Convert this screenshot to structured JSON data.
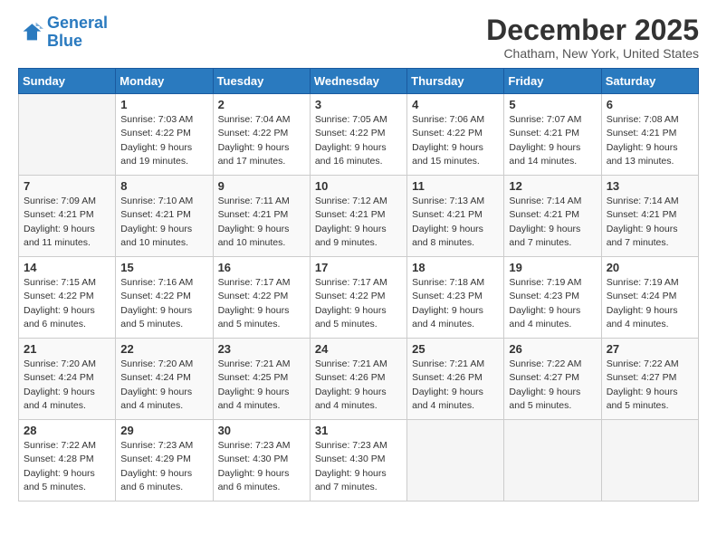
{
  "header": {
    "logo_line1": "General",
    "logo_line2": "Blue",
    "month": "December 2025",
    "location": "Chatham, New York, United States"
  },
  "days_of_week": [
    "Sunday",
    "Monday",
    "Tuesday",
    "Wednesday",
    "Thursday",
    "Friday",
    "Saturday"
  ],
  "weeks": [
    [
      {
        "num": "",
        "info": ""
      },
      {
        "num": "1",
        "info": "Sunrise: 7:03 AM\nSunset: 4:22 PM\nDaylight: 9 hours\nand 19 minutes."
      },
      {
        "num": "2",
        "info": "Sunrise: 7:04 AM\nSunset: 4:22 PM\nDaylight: 9 hours\nand 17 minutes."
      },
      {
        "num": "3",
        "info": "Sunrise: 7:05 AM\nSunset: 4:22 PM\nDaylight: 9 hours\nand 16 minutes."
      },
      {
        "num": "4",
        "info": "Sunrise: 7:06 AM\nSunset: 4:22 PM\nDaylight: 9 hours\nand 15 minutes."
      },
      {
        "num": "5",
        "info": "Sunrise: 7:07 AM\nSunset: 4:21 PM\nDaylight: 9 hours\nand 14 minutes."
      },
      {
        "num": "6",
        "info": "Sunrise: 7:08 AM\nSunset: 4:21 PM\nDaylight: 9 hours\nand 13 minutes."
      }
    ],
    [
      {
        "num": "7",
        "info": "Sunrise: 7:09 AM\nSunset: 4:21 PM\nDaylight: 9 hours\nand 11 minutes."
      },
      {
        "num": "8",
        "info": "Sunrise: 7:10 AM\nSunset: 4:21 PM\nDaylight: 9 hours\nand 10 minutes."
      },
      {
        "num": "9",
        "info": "Sunrise: 7:11 AM\nSunset: 4:21 PM\nDaylight: 9 hours\nand 10 minutes."
      },
      {
        "num": "10",
        "info": "Sunrise: 7:12 AM\nSunset: 4:21 PM\nDaylight: 9 hours\nand 9 minutes."
      },
      {
        "num": "11",
        "info": "Sunrise: 7:13 AM\nSunset: 4:21 PM\nDaylight: 9 hours\nand 8 minutes."
      },
      {
        "num": "12",
        "info": "Sunrise: 7:14 AM\nSunset: 4:21 PM\nDaylight: 9 hours\nand 7 minutes."
      },
      {
        "num": "13",
        "info": "Sunrise: 7:14 AM\nSunset: 4:21 PM\nDaylight: 9 hours\nand 7 minutes."
      }
    ],
    [
      {
        "num": "14",
        "info": "Sunrise: 7:15 AM\nSunset: 4:22 PM\nDaylight: 9 hours\nand 6 minutes."
      },
      {
        "num": "15",
        "info": "Sunrise: 7:16 AM\nSunset: 4:22 PM\nDaylight: 9 hours\nand 5 minutes."
      },
      {
        "num": "16",
        "info": "Sunrise: 7:17 AM\nSunset: 4:22 PM\nDaylight: 9 hours\nand 5 minutes."
      },
      {
        "num": "17",
        "info": "Sunrise: 7:17 AM\nSunset: 4:22 PM\nDaylight: 9 hours\nand 5 minutes."
      },
      {
        "num": "18",
        "info": "Sunrise: 7:18 AM\nSunset: 4:23 PM\nDaylight: 9 hours\nand 4 minutes."
      },
      {
        "num": "19",
        "info": "Sunrise: 7:19 AM\nSunset: 4:23 PM\nDaylight: 9 hours\nand 4 minutes."
      },
      {
        "num": "20",
        "info": "Sunrise: 7:19 AM\nSunset: 4:24 PM\nDaylight: 9 hours\nand 4 minutes."
      }
    ],
    [
      {
        "num": "21",
        "info": "Sunrise: 7:20 AM\nSunset: 4:24 PM\nDaylight: 9 hours\nand 4 minutes."
      },
      {
        "num": "22",
        "info": "Sunrise: 7:20 AM\nSunset: 4:24 PM\nDaylight: 9 hours\nand 4 minutes."
      },
      {
        "num": "23",
        "info": "Sunrise: 7:21 AM\nSunset: 4:25 PM\nDaylight: 9 hours\nand 4 minutes."
      },
      {
        "num": "24",
        "info": "Sunrise: 7:21 AM\nSunset: 4:26 PM\nDaylight: 9 hours\nand 4 minutes."
      },
      {
        "num": "25",
        "info": "Sunrise: 7:21 AM\nSunset: 4:26 PM\nDaylight: 9 hours\nand 4 minutes."
      },
      {
        "num": "26",
        "info": "Sunrise: 7:22 AM\nSunset: 4:27 PM\nDaylight: 9 hours\nand 5 minutes."
      },
      {
        "num": "27",
        "info": "Sunrise: 7:22 AM\nSunset: 4:27 PM\nDaylight: 9 hours\nand 5 minutes."
      }
    ],
    [
      {
        "num": "28",
        "info": "Sunrise: 7:22 AM\nSunset: 4:28 PM\nDaylight: 9 hours\nand 5 minutes."
      },
      {
        "num": "29",
        "info": "Sunrise: 7:23 AM\nSunset: 4:29 PM\nDaylight: 9 hours\nand 6 minutes."
      },
      {
        "num": "30",
        "info": "Sunrise: 7:23 AM\nSunset: 4:30 PM\nDaylight: 9 hours\nand 6 minutes."
      },
      {
        "num": "31",
        "info": "Sunrise: 7:23 AM\nSunset: 4:30 PM\nDaylight: 9 hours\nand 7 minutes."
      },
      {
        "num": "",
        "info": ""
      },
      {
        "num": "",
        "info": ""
      },
      {
        "num": "",
        "info": ""
      }
    ]
  ]
}
